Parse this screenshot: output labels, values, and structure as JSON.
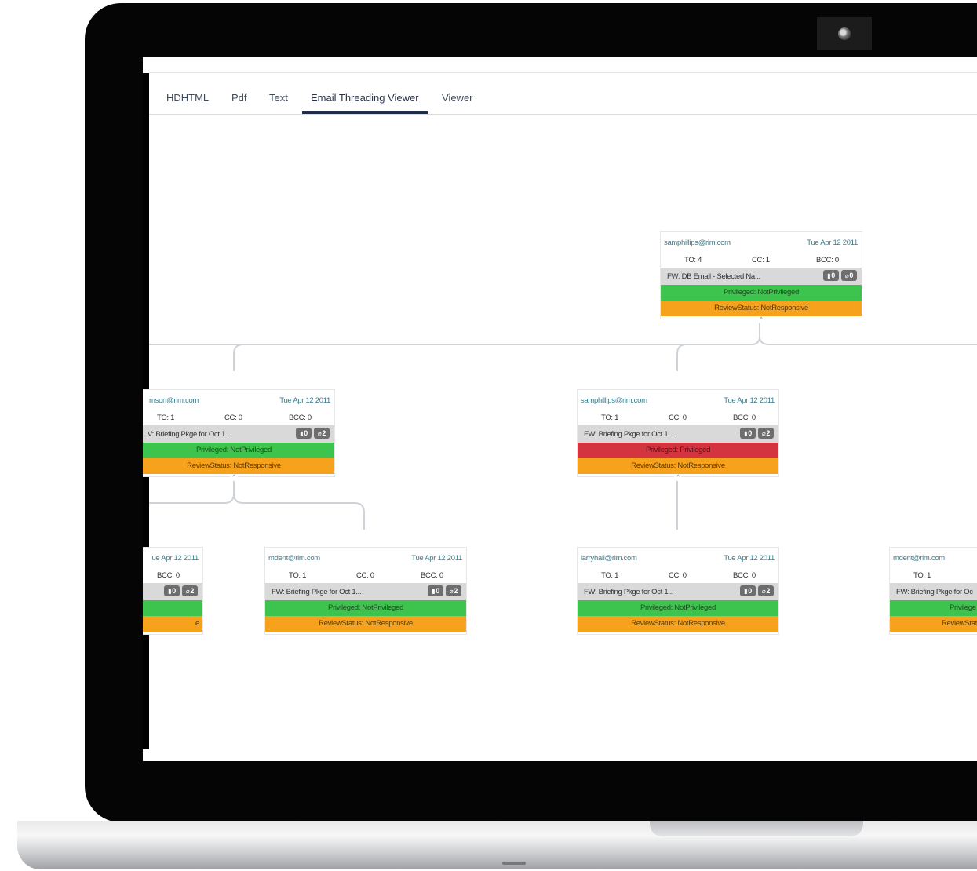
{
  "tabs": [
    {
      "label": "HDHTML"
    },
    {
      "label": "Pdf"
    },
    {
      "label": "Text"
    },
    {
      "label": "Email Threading Viewer",
      "active": true
    },
    {
      "label": "Viewer"
    }
  ],
  "colors": {
    "privileged_green": "#3dc44f",
    "privileged_red": "#d3343f",
    "review_orange": "#f6a21c",
    "subject_gray": "#d9d9d9"
  },
  "nodes": {
    "root": {
      "sender": "samphillips@rim.com",
      "date": "Tue Apr 12 2011",
      "to": "TO: 4",
      "cc": "CC: 1",
      "bcc": "BCC: 0",
      "subject": "FW: DB Email - Selected Na...",
      "badge1": "0",
      "badge2": "0",
      "privileged": "Privileged: NotPrivileged",
      "review": "ReviewStatus: NotResponsive"
    },
    "mid_left": {
      "sender": "mson@rim.com",
      "date": "Tue Apr 12 2011",
      "to": "TO: 1",
      "cc": "CC: 0",
      "bcc": "BCC: 0",
      "subject": "V: Briefing Pkge for Oct 1...",
      "badge1": "0",
      "badge2": "2",
      "privileged": "Privileged: NotPrivileged",
      "review": "ReviewStatus: NotResponsive"
    },
    "mid_right": {
      "sender": "samphillips@rim.com",
      "date": "Tue Apr 12 2011",
      "to": "TO: 1",
      "cc": "CC: 0",
      "bcc": "BCC: 0",
      "subject": "FW: Briefing Pkge for Oct 1...",
      "badge1": "0",
      "badge2": "2",
      "privileged": "Privileged: Privileged",
      "review": "ReviewStatus: NotResponsive"
    },
    "leaf_a": {
      "date": "ue Apr 12 2011",
      "bcc": "BCC: 0",
      "badge1": "0",
      "badge2": "2",
      "review": "e"
    },
    "leaf_b": {
      "sender": "mdent@rim.com",
      "date": "Tue Apr 12 2011",
      "to": "TO: 1",
      "cc": "CC: 0",
      "bcc": "BCC: 0",
      "subject": "FW: Briefing Pkge for Oct 1...",
      "badge1": "0",
      "badge2": "2",
      "privileged": "Privileged: NotPrivileged",
      "review": "ReviewStatus: NotResponsive"
    },
    "leaf_c": {
      "sender": "larryhall@rim.com",
      "date": "Tue Apr 12 2011",
      "to": "TO: 1",
      "cc": "CC: 0",
      "bcc": "BCC: 0",
      "subject": "FW: Briefing Pkge for Oct 1...",
      "badge1": "0",
      "badge2": "2",
      "privileged": "Privileged: NotPrivileged",
      "review": "ReviewStatus: NotResponsive"
    },
    "leaf_d": {
      "sender": "mdent@rim.com",
      "to": "TO: 1",
      "subject": "FW: Briefing Pkge for Oc",
      "privileged": "Privilege",
      "review": "ReviewStat"
    }
  }
}
